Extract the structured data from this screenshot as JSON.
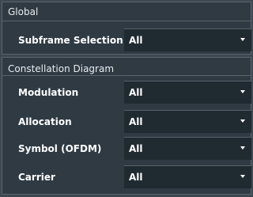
{
  "global": {
    "title": "Global",
    "subframe_selection": {
      "label": "Subframe Selection",
      "value": "All"
    }
  },
  "constellation": {
    "title": "Constellation Diagram",
    "rows": [
      {
        "label": "Modulation",
        "value": "All"
      },
      {
        "label": "Allocation",
        "value": "All"
      },
      {
        "label": "Symbol (OFDM)",
        "value": "All"
      },
      {
        "label": "Carrier",
        "value": "All"
      }
    ]
  },
  "icons": {
    "dropdown": "chevron-down-icon"
  },
  "colors": {
    "background": "#3d4851",
    "panel": "#2f3a43",
    "field": "#202a31",
    "border": "#59646c",
    "text": "#ffffff"
  }
}
